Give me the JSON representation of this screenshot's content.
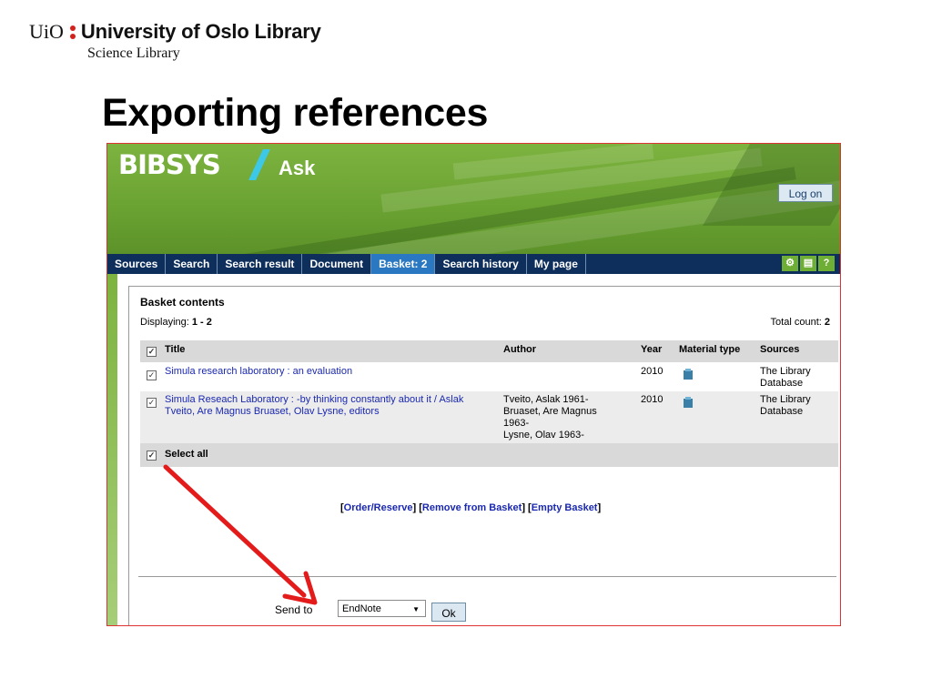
{
  "slide": {
    "logo_uio": "UiO",
    "logo_title": "University of Oslo Library",
    "logo_sub": "Science Library",
    "title": "Exporting references"
  },
  "app": {
    "brand": "BIBSYS",
    "product": "Ask",
    "logon_label": "Log on"
  },
  "nav": {
    "tabs": [
      "Sources",
      "Search",
      "Search result",
      "Document",
      "Basket: 2",
      "Search history",
      "My page"
    ],
    "active_index": 4,
    "icons": [
      "tools-icon",
      "print-icon",
      "help-icon"
    ]
  },
  "basket": {
    "heading": "Basket contents",
    "displaying_label": "Displaying:",
    "displaying_value": "1 - 2",
    "total_label": "Total count:",
    "total_value": "2",
    "columns": [
      "Title",
      "Author",
      "Year",
      "Material type",
      "Sources"
    ],
    "rows": [
      {
        "title": "Simula research laboratory : an evaluation",
        "author": "",
        "year": "2010",
        "source_1": "The Library",
        "source_2": "Database"
      },
      {
        "title_1": "Simula Reseach Laboratory : -by thinking constantly about it / Aslak",
        "title_2": "Tveito, Are Magnus Bruaset, Olav Lysne, editors",
        "author_1": "Tveito, Aslak 1961-",
        "author_2": "Bruaset, Are Magnus",
        "author_3": "1963-",
        "author_4": "Lysne, Olav 1963-",
        "year": "2010",
        "source_1": "The Library",
        "source_2": "Database"
      }
    ],
    "select_all": "Select all",
    "actions": {
      "order": "Order/Reserve",
      "remove": "Remove from Basket",
      "empty": "Empty Basket"
    },
    "send_to_label": "Send to",
    "send_to_value": "EndNote",
    "ok_label": "Ok"
  },
  "colors": {
    "accent_red": "#d5211c",
    "nav_bg": "#0e2f5c",
    "nav_active": "#2a78c1",
    "link": "#1a28b0",
    "arrow": "#e31b1b"
  }
}
